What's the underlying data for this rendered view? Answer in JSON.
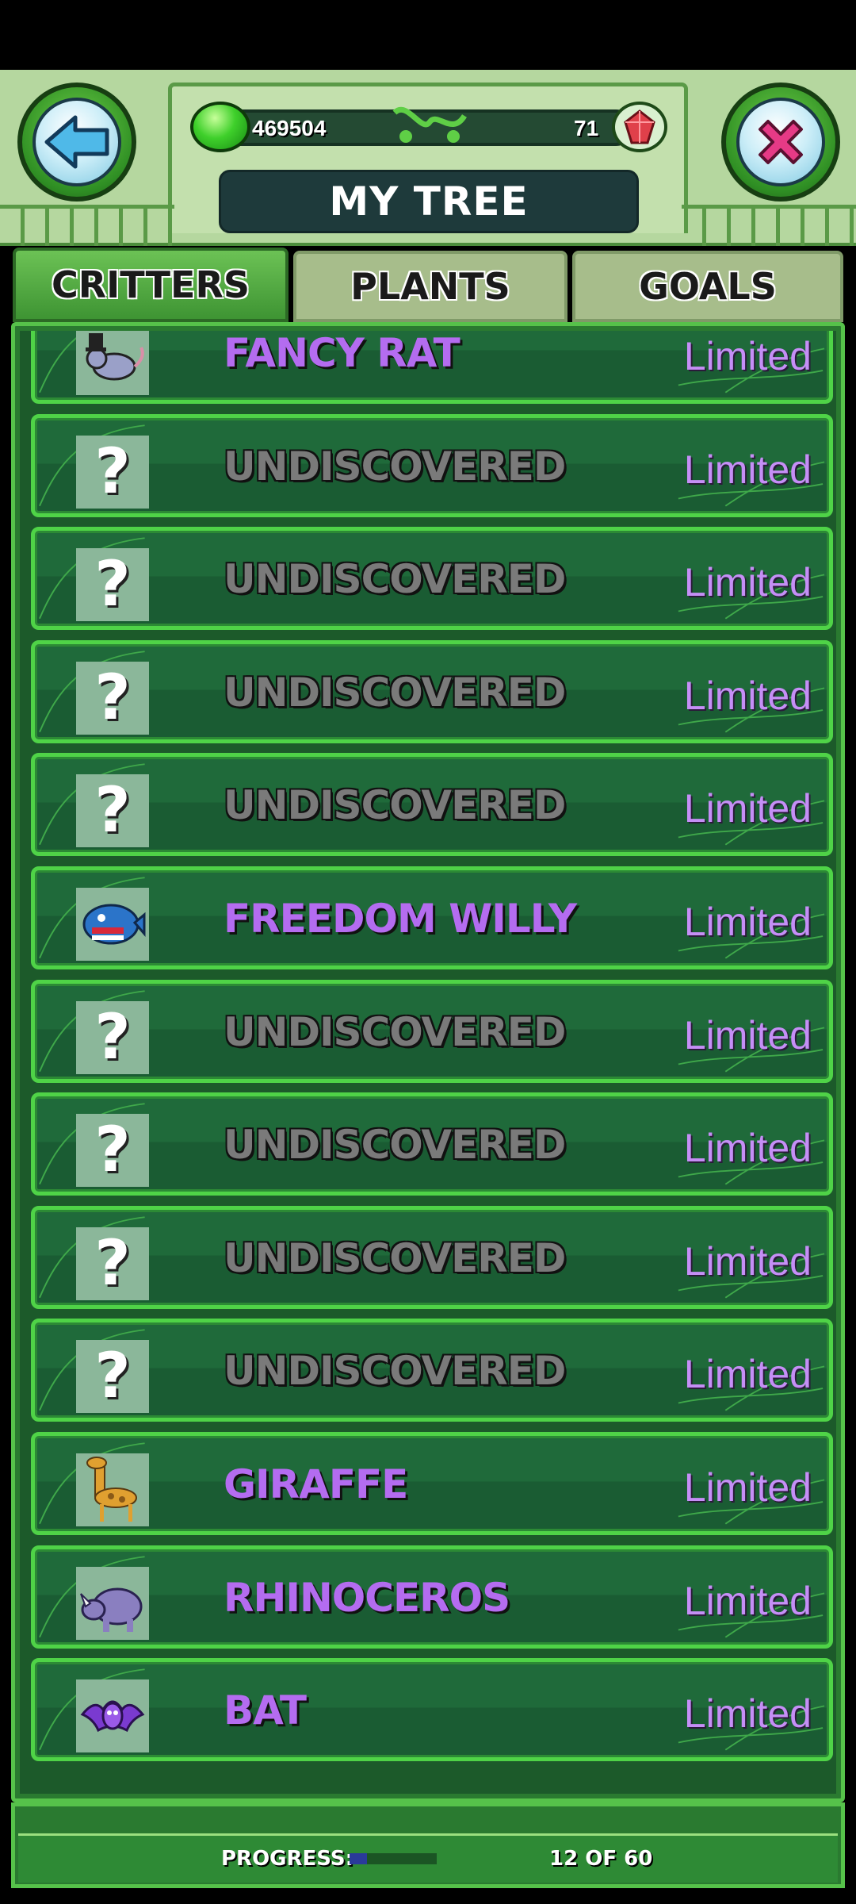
{
  "header": {
    "title": "MY TREE",
    "coins": "469504",
    "gems": "71",
    "back_icon": "arrow-left-icon",
    "close_icon": "x-close-icon",
    "coin_icon": "green-gem-icon",
    "gem_icon": "red-crystal-icon"
  },
  "tabs": [
    {
      "label": "CRITTERS",
      "active": true
    },
    {
      "label": "PLANTS",
      "active": false
    },
    {
      "label": "GOALS",
      "active": false
    }
  ],
  "critters": [
    {
      "name": "FANCY RAT",
      "status": "Limited",
      "discovered": true,
      "icon": "fancy-rat-icon"
    },
    {
      "name": "UNDISCOVERED",
      "status": "Limited",
      "discovered": false,
      "icon": "question-mark-icon"
    },
    {
      "name": "UNDISCOVERED",
      "status": "Limited",
      "discovered": false,
      "icon": "question-mark-icon"
    },
    {
      "name": "UNDISCOVERED",
      "status": "Limited",
      "discovered": false,
      "icon": "question-mark-icon"
    },
    {
      "name": "UNDISCOVERED",
      "status": "Limited",
      "discovered": false,
      "icon": "question-mark-icon"
    },
    {
      "name": "FREEDOM WILLY",
      "status": "Limited",
      "discovered": true,
      "icon": "whale-icon"
    },
    {
      "name": "UNDISCOVERED",
      "status": "Limited",
      "discovered": false,
      "icon": "question-mark-icon"
    },
    {
      "name": "UNDISCOVERED",
      "status": "Limited",
      "discovered": false,
      "icon": "question-mark-icon"
    },
    {
      "name": "UNDISCOVERED",
      "status": "Limited",
      "discovered": false,
      "icon": "question-mark-icon"
    },
    {
      "name": "UNDISCOVERED",
      "status": "Limited",
      "discovered": false,
      "icon": "question-mark-icon"
    },
    {
      "name": "GIRAFFE",
      "status": "Limited",
      "discovered": true,
      "icon": "giraffe-icon"
    },
    {
      "name": "RHINOCEROS",
      "status": "Limited",
      "discovered": true,
      "icon": "rhinoceros-icon"
    },
    {
      "name": "BAT",
      "status": "Limited",
      "discovered": true,
      "icon": "bat-icon"
    }
  ],
  "footer": {
    "progress_label": "PROGRESS:",
    "progress_count": "12 OF 60",
    "progress_fraction": 0.2
  },
  "colors": {
    "known_name": "#b46cf0",
    "unknown_name": "#7a7a7a",
    "limited": "#c58ff6",
    "row_border": "#4fd347"
  }
}
